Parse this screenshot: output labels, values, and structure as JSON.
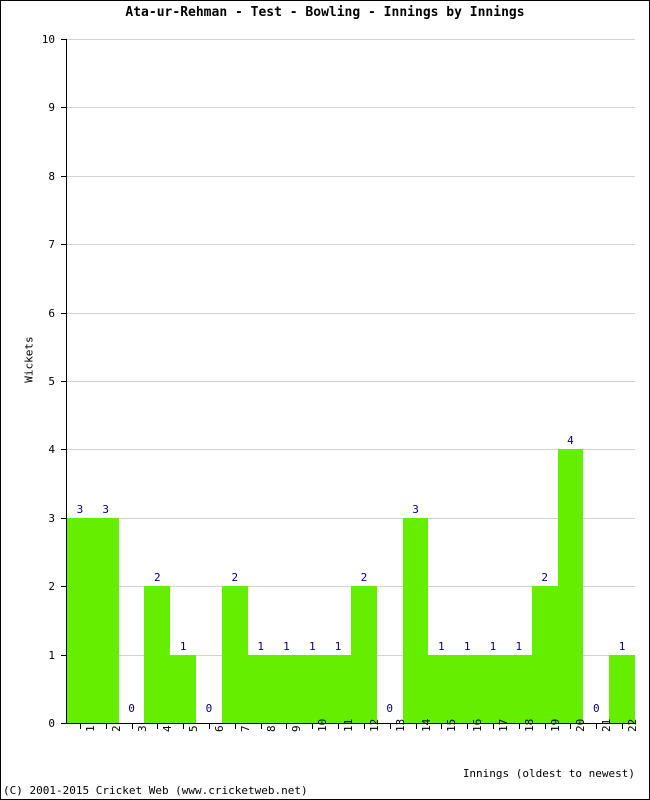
{
  "footer": {
    "copyright": "(C) 2001-2015 Cricket Web (www.cricketweb.net)"
  },
  "colors": {
    "bar": "#66EE00",
    "value_label": "#000080",
    "gridline": "#D2D2D2",
    "axis": "#000000",
    "background": "#FFFFFF"
  },
  "chart_data": {
    "type": "bar",
    "title": "Ata-ur-Rehman - Test - Bowling - Innings by Innings",
    "xlabel": "Innings (oldest to newest)",
    "ylabel": "Wickets",
    "ylim": [
      0,
      10
    ],
    "ytick_step": 1,
    "yticks": [
      "0",
      "1",
      "2",
      "3",
      "4",
      "5",
      "6",
      "7",
      "8",
      "9",
      "10"
    ],
    "grid": true,
    "legend": false,
    "categories": [
      "1",
      "2",
      "3",
      "4",
      "5",
      "6",
      "7",
      "8",
      "9",
      "10",
      "11",
      "12",
      "13",
      "14",
      "15",
      "16",
      "17",
      "18",
      "19",
      "20",
      "21",
      "22"
    ],
    "values": [
      3,
      3,
      0,
      2,
      1,
      0,
      2,
      1,
      1,
      1,
      1,
      2,
      0,
      3,
      1,
      1,
      1,
      1,
      2,
      4,
      0,
      1
    ],
    "value_labels": [
      "3",
      "3",
      "0",
      "2",
      "1",
      "0",
      "2",
      "1",
      "1",
      "1",
      "1",
      "2",
      "0",
      "3",
      "1",
      "1",
      "1",
      "1",
      "2",
      "4",
      "0",
      "1"
    ]
  }
}
